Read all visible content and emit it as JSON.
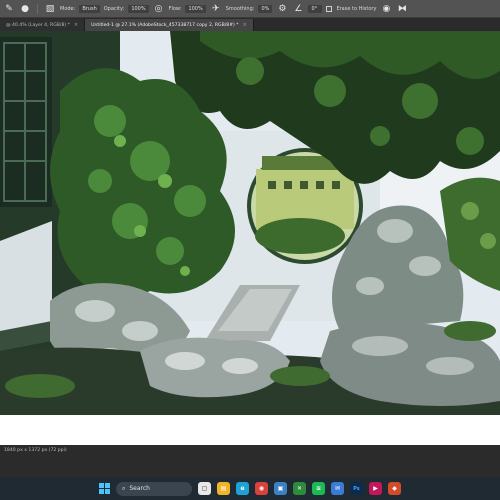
{
  "options_bar": {
    "tool_icon": "mixer-brush-icon",
    "mode_label": "Mode:",
    "mode_value": "Brush",
    "opacity_label": "Opacity:",
    "opacity_value": "100%",
    "flow_label": "Flow:",
    "flow_value": "100%",
    "smoothing_label": "Smoothing:",
    "smoothing_value": "0%",
    "angle_value": "0°",
    "erase_history_label": "Erase to History"
  },
  "tabs": [
    {
      "label": "@ 40.4% (Layer 4, RGB/8) *",
      "active": false
    },
    {
      "label": "Untitled-1 @ 27.1% (AdobeStock_457338717 copy 2, RGB/8#) *",
      "active": true
    }
  ],
  "status": {
    "doc_size": "1840 px x 1372 px (72 ppi)",
    "arrow": ">"
  },
  "taskbar": {
    "search_label": "Search",
    "apps": [
      {
        "name": "widgets",
        "color": "#3aa0d8",
        "glyph": "▦"
      },
      {
        "name": "start",
        "color": "#e8e8e8",
        "glyph": ""
      },
      {
        "name": "file-explorer",
        "color": "#f0b429",
        "glyph": "▤"
      },
      {
        "name": "edge",
        "color": "#1fa2d6",
        "glyph": "e"
      },
      {
        "name": "chrome",
        "color": "#d9423a",
        "glyph": "◉"
      },
      {
        "name": "store",
        "color": "#3b82c4",
        "glyph": "▣"
      },
      {
        "name": "xbox",
        "color": "#2e8b3a",
        "glyph": "✕"
      },
      {
        "name": "spotify",
        "color": "#1db954",
        "glyph": "≋"
      },
      {
        "name": "mail",
        "color": "#3a7bd5",
        "glyph": "✉"
      },
      {
        "name": "photoshop",
        "color": "#0f2a4a",
        "glyph": "Ps"
      },
      {
        "name": "media",
        "color": "#c2185b",
        "glyph": "▶"
      },
      {
        "name": "app-extra",
        "color": "#d24b2a",
        "glyph": "◆"
      }
    ]
  },
  "colors": {
    "accent": "#4cc2ff",
    "panel": "#535353",
    "canvas_bg": "#262626"
  }
}
